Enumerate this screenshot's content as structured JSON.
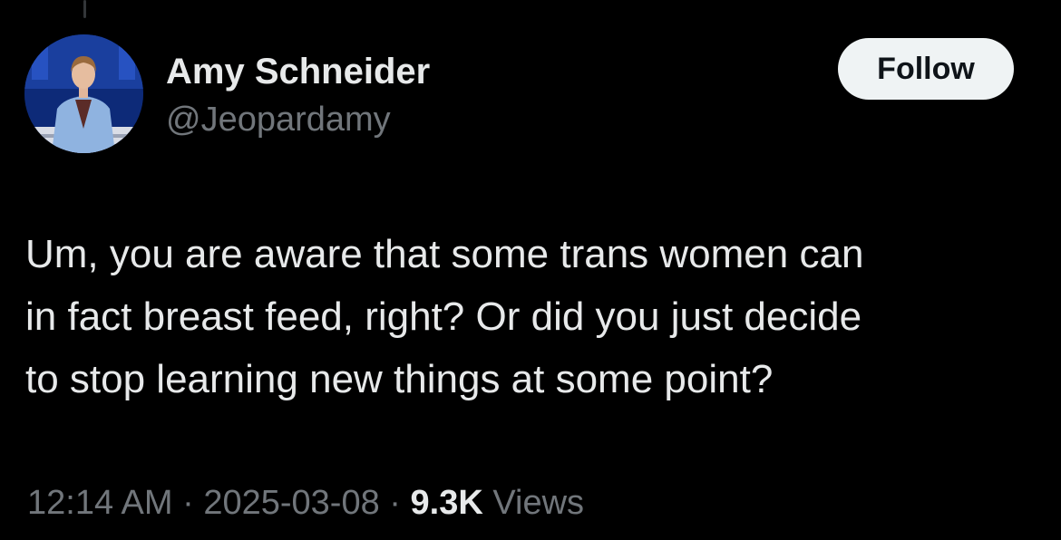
{
  "author": {
    "display_name": "Amy Schneider",
    "handle": "@Jeopardamy"
  },
  "follow_button": {
    "label": "Follow"
  },
  "tweet": {
    "lines": [
      "Um, you are aware that some trans women can",
      "in fact breast feed, right? Or did you just decide",
      "to stop learning new things at some point?"
    ]
  },
  "meta": {
    "time": "12:14 AM",
    "separator": " · ",
    "date": "2025-03-08",
    "views_count": "9.3K",
    "views_label": " Views"
  },
  "colors": {
    "background": "#000000",
    "text_primary": "#e7e9ea",
    "text_secondary": "#71767b",
    "follow_bg": "#eff3f4",
    "follow_text": "#0f1419"
  }
}
